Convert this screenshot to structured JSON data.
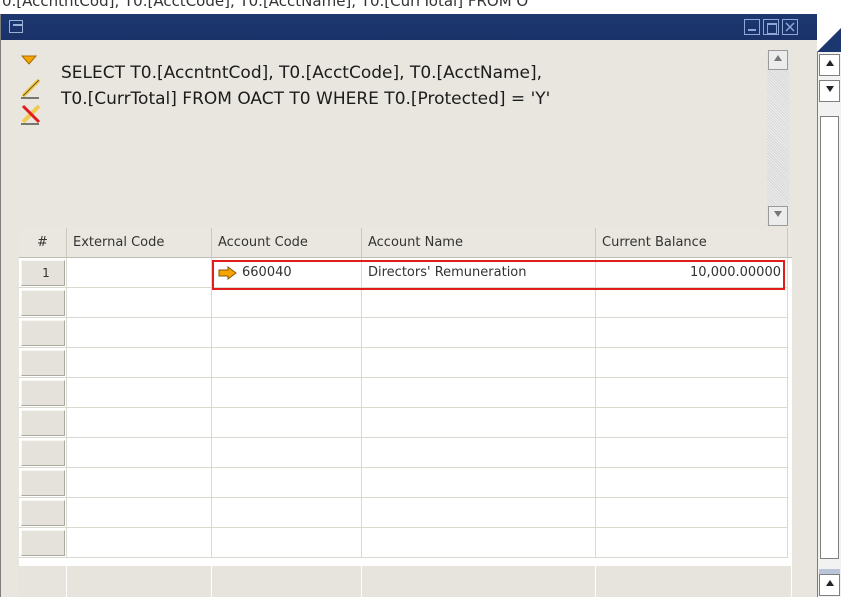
{
  "background_text": "0.[AccntntCod], T0.[AcctCode], T0.[AcctName], T0.[CurrTotal] FROM O",
  "window": {
    "controls": {
      "minimize": "",
      "maximize": "",
      "close": ""
    }
  },
  "query": {
    "text": "SELECT T0.[AccntntCod], T0.[AcctCode], T0.[AcctName],\nT0.[CurrTotal] FROM OACT T0 WHERE T0.[Protected] = 'Y'",
    "tools": [
      "execute-arrow-icon",
      "edit-pencil-icon",
      "clear-pencil-icon"
    ]
  },
  "grid": {
    "columns": [
      "#",
      "External Code",
      "Account Code",
      "Account Name",
      "Current Balance"
    ],
    "rows": [
      {
        "num": "1",
        "external_code": "",
        "account_code": "660040",
        "account_name": "Directors' Remuneration",
        "current_balance": "10,000.00000"
      }
    ],
    "empty_rows": 9
  },
  "colors": {
    "titlebar": "#1c3770",
    "highlight": "#e21b1b",
    "link_arrow": "#f5a400"
  }
}
